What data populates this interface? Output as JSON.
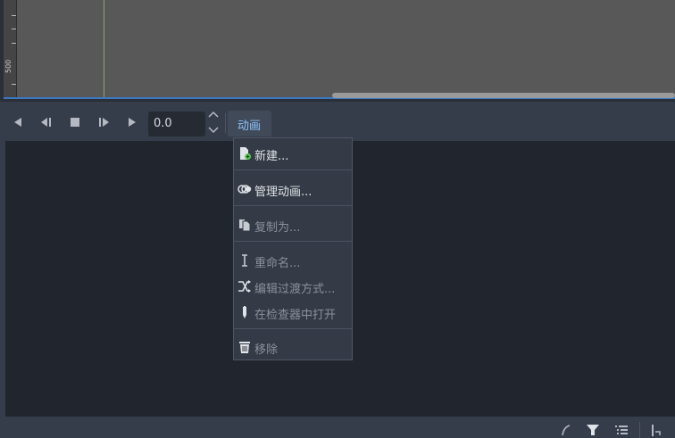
{
  "viewport": {
    "ruler_label": "500"
  },
  "toolbar": {
    "buttons": [
      {
        "icon": "play-backward-icon"
      },
      {
        "icon": "play-backward-from-end-icon"
      },
      {
        "icon": "stop-icon"
      },
      {
        "icon": "play-from-start-icon"
      },
      {
        "icon": "play-icon"
      }
    ],
    "position_value": "0.0",
    "animation_menu_label": "动画"
  },
  "animation_menu": {
    "items": [
      {
        "label": "新建...",
        "icon": "new-file-icon",
        "enabled": true
      },
      {
        "label": "管理动画...",
        "icon": "animation-library-icon",
        "enabled": true
      },
      {
        "label": "复制为...",
        "icon": "duplicate-icon",
        "enabled": false
      },
      {
        "label": "重命名...",
        "icon": "rename-cursor-icon",
        "enabled": false
      },
      {
        "label": "编辑过渡方式...",
        "icon": "shuffle-icon",
        "enabled": false
      },
      {
        "label": "在检查器中打开",
        "icon": "pen-icon",
        "enabled": false
      },
      {
        "label": "移除",
        "icon": "trash-icon",
        "enabled": false
      }
    ]
  },
  "bottombar": {
    "icons": [
      "bezier-curve-icon",
      "filter-icon",
      "list-icon",
      "insert-key-icon"
    ]
  },
  "colors": {
    "accent": "#3b78c4",
    "menu_label_link": "#8ec6ff"
  }
}
